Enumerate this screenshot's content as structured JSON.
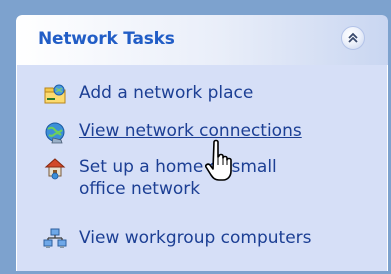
{
  "panel": {
    "title": "Network Tasks",
    "collapse_icon": "double-chevron-up-icon",
    "colors": {
      "title": "#215dc6",
      "link": "#1c3f94",
      "body_bg": "#d6dff7",
      "window_bg": "#7da2ce"
    }
  },
  "tasks": [
    {
      "label": "Add a network place",
      "icon": "network-place-icon"
    },
    {
      "label": "View network connections",
      "icon": "network-connections-icon"
    },
    {
      "label": "Set up a home or small office network",
      "icon": "home-network-icon"
    },
    {
      "label": "View workgroup computers",
      "icon": "workgroup-computers-icon"
    }
  ],
  "cursor": {
    "icon": "hand-pointer-icon"
  }
}
